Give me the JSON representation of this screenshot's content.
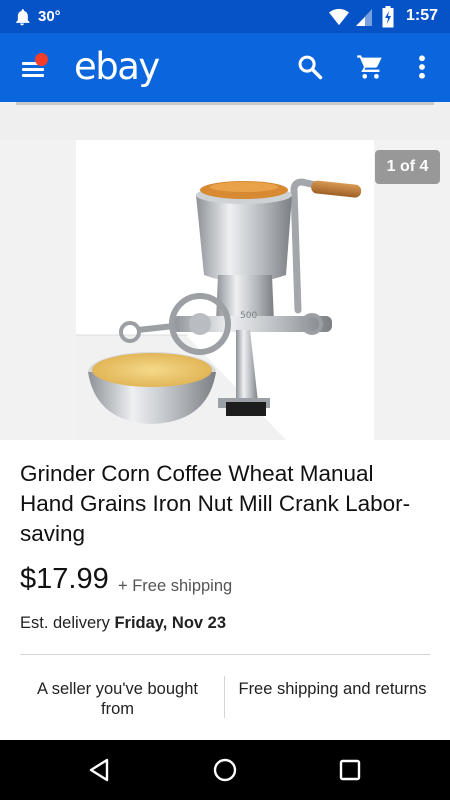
{
  "status_bar": {
    "notification_icon": "bell-icon",
    "temperature": "30°",
    "time": "1:57",
    "icons": [
      "wifi-icon",
      "signal-icon",
      "battery-charging-icon"
    ]
  },
  "app_bar": {
    "logo": "ebay",
    "icons": [
      "menu-icon",
      "search-icon",
      "cart-icon",
      "more-vert-icon"
    ],
    "colors": {
      "background": "#0b66dd",
      "status": "#0653c7",
      "badge": "#f43d2a"
    }
  },
  "image": {
    "counter": "1 of 4",
    "subject": "grinder-image"
  },
  "listing": {
    "title": "Grinder Corn Coffee Wheat Manual Hand Grains Iron Nut Mill Crank Labor-saving",
    "price": "$17.99",
    "shipping": "+ Free shipping",
    "delivery_prefix": "Est. delivery",
    "delivery_date": "Friday, Nov 23"
  },
  "features": [
    {
      "label": "A seller you've bought from"
    },
    {
      "label": "Free shipping and returns"
    }
  ],
  "nav_bar": {
    "icons": [
      "back-icon",
      "home-icon",
      "recents-icon"
    ]
  }
}
